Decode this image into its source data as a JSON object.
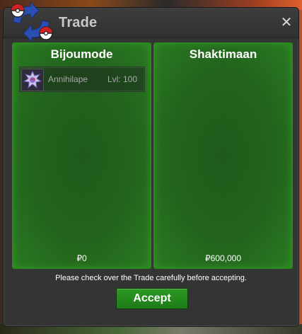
{
  "window": {
    "title": "Trade",
    "close_glyph": "✕",
    "icon": "trade-pokeball-arrows-icon"
  },
  "left_panel": {
    "player_name": "Bijoumode",
    "items": [
      {
        "pokemon_name": "Annihilape",
        "level_text": "Lvl: 100",
        "icon": "annihilape-sprite-icon"
      }
    ],
    "money": "₽0"
  },
  "right_panel": {
    "player_name": "Shaktimaan",
    "items": [],
    "money": "₽600,000"
  },
  "notice_text": "Please check over the Trade carefully before accepting.",
  "accept_label": "Accept",
  "colors": {
    "panel_green": "#22641d",
    "panel_border": "#2a8a1e",
    "accept_green": "#2c9a22",
    "window_bg": "#343434"
  }
}
